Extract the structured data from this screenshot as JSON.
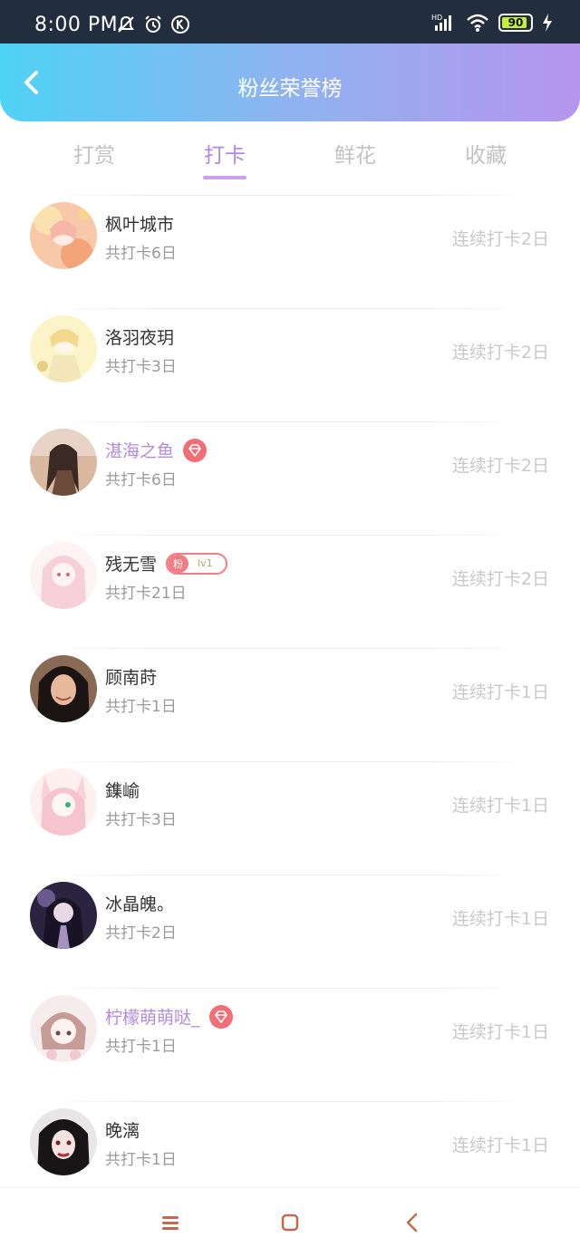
{
  "status_bar": {
    "time": "8:00 PM",
    "battery": "90",
    "left_icons": [
      "mute-bell-icon",
      "alarm-icon",
      "k-app-icon"
    ],
    "right_icons": [
      "hd-signal-icon",
      "wifi-icon",
      "battery-icon",
      "charging-icon"
    ]
  },
  "header": {
    "title": "粉丝荣誉榜",
    "back_icon": "chevron-left-icon",
    "colors": {
      "gradient_start": "#4fd2f4",
      "gradient_end": "#b695ec"
    }
  },
  "tabs": [
    {
      "label": "打赏",
      "active": false
    },
    {
      "label": "打卡",
      "active": true
    },
    {
      "label": "鲜花",
      "active": false
    },
    {
      "label": "收藏",
      "active": false
    }
  ],
  "rows": [
    {
      "name": "枫叶城市",
      "total": "共打卡6日",
      "streak": "连续打卡2日",
      "vip": false,
      "badge": ""
    },
    {
      "name": "洛羽夜玥",
      "total": "共打卡3日",
      "streak": "连续打卡2日",
      "vip": false,
      "badge": ""
    },
    {
      "name": "湛海之鱼",
      "total": "共打卡6日",
      "streak": "连续打卡2日",
      "vip": true,
      "badge": "diamond"
    },
    {
      "name": "残无雪",
      "total": "共打卡21日",
      "streak": "连续打卡2日",
      "vip": false,
      "badge": "fan",
      "fan_label": "粉",
      "fan_level": "lv1"
    },
    {
      "name": "顾南莳",
      "total": "共打卡1日",
      "streak": "连续打卡1日",
      "vip": false,
      "badge": ""
    },
    {
      "name": "鏶崳",
      "total": "共打卡3日",
      "streak": "连续打卡1日",
      "vip": false,
      "badge": ""
    },
    {
      "name": "冰晶魄。",
      "total": "共打卡2日",
      "streak": "连续打卡1日",
      "vip": false,
      "badge": ""
    },
    {
      "name": "柠檬萌萌哒_",
      "total": "共打卡1日",
      "streak": "连续打卡1日",
      "vip": true,
      "badge": "diamond"
    },
    {
      "name": "晚漓",
      "total": "共打卡1日",
      "streak": "连续打卡1日",
      "vip": false,
      "badge": ""
    }
  ],
  "colors": {
    "accent": "#b388e6",
    "vip_name": "#b38be0",
    "badge_red": "#f06f76",
    "streak_text": "#c9c9c9"
  },
  "nav_bar": {
    "icons": [
      "menu-icon",
      "home-square-icon",
      "back-triangle-icon"
    ]
  }
}
